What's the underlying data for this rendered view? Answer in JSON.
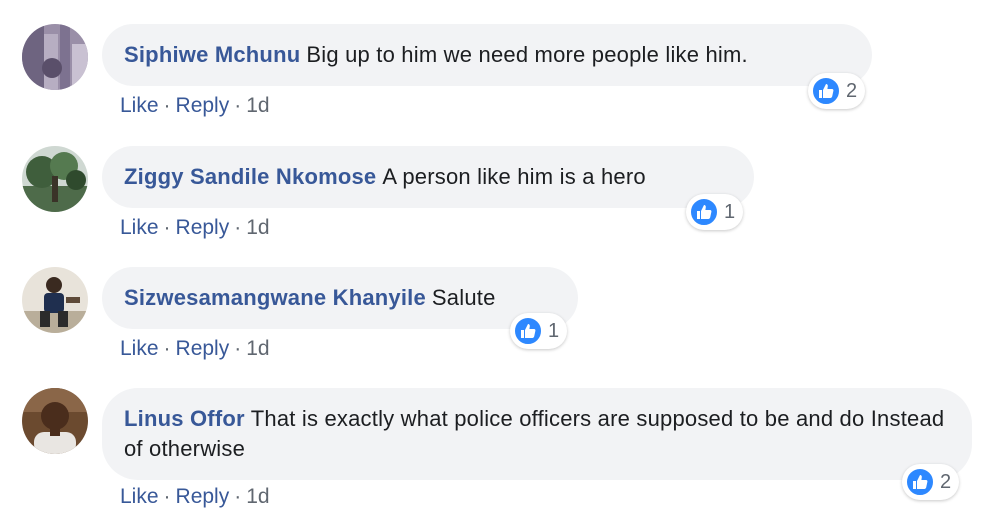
{
  "comments": [
    {
      "author": "Siphiwe Mchunu",
      "text": "Big up to him we need more people like him.",
      "reaction_count": "2",
      "actions": {
        "like": "Like",
        "reply": "Reply",
        "time": "1d"
      }
    },
    {
      "author": "Ziggy Sandile Nkomose",
      "text": "A person like him is a hero",
      "reaction_count": "1",
      "actions": {
        "like": "Like",
        "reply": "Reply",
        "time": "1d"
      }
    },
    {
      "author": "Sizwesamangwane Khanyile",
      "text": "Salute",
      "reaction_count": "1",
      "actions": {
        "like": "Like",
        "reply": "Reply",
        "time": "1d"
      }
    },
    {
      "author": "Linus Offor",
      "text": "That is exactly what police officers are supposed to be and do Instead of otherwise",
      "reaction_count": "2",
      "actions": {
        "like": "Like",
        "reply": "Reply",
        "time": "1d"
      }
    }
  ],
  "separator": "·",
  "icons": {
    "reaction": "thumbs-up-icon"
  },
  "colors": {
    "author_link": "#385898",
    "bubble_bg": "#f2f3f5",
    "like_blue": "#2d88ff",
    "meta_gray": "#606770"
  }
}
